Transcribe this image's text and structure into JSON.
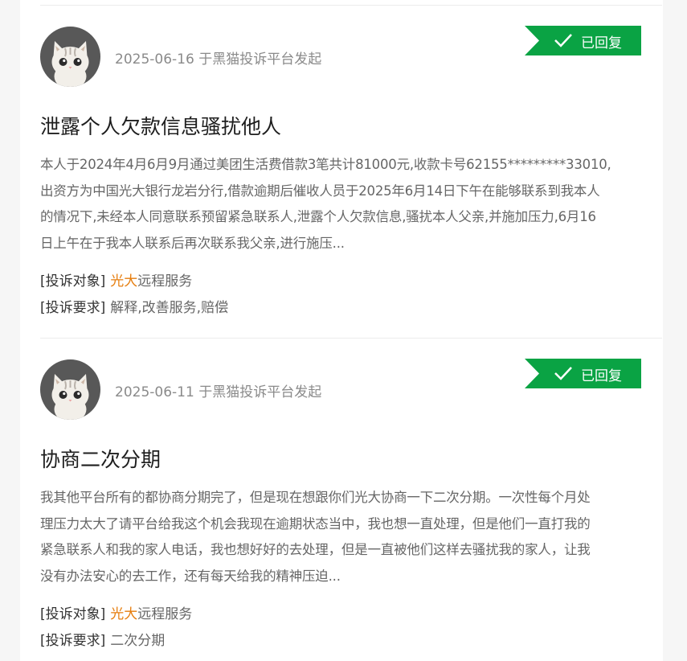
{
  "complaints": [
    {
      "date": "2025-06-16",
      "source": "于黑猫投诉平台发起",
      "status": "已回复",
      "title": "泄露个人欠款信息骚扰他人",
      "body_lines": [
        "本人于2024年4月6月9月通过美团生活费借款3笔共计81000元,收款卡号62155*********33010,",
        "出资方为中国光大银行龙岩分行,借款逾期后催收人员于2025年6月14日下午在能够联系到我本人",
        "的情况下,未经本人同意联系预留紧急联系人,泄露个人欠款信息,骚扰本人父亲,并施加压力,6月16",
        "日上午在于我本人联系后再次联系我父亲,进行施压..."
      ],
      "target_label": "[投诉对象]",
      "target_highlight": "光大",
      "target_rest": "远程服务",
      "request_label": "[投诉要求]",
      "request_value": "解释,改善服务,赔偿"
    },
    {
      "date": "2025-06-11",
      "source": "于黑猫投诉平台发起",
      "status": "已回复",
      "title": "协商二次分期",
      "body_lines": [
        "我其他平台所有的都协商分期完了，但是现在想跟你们光大协商一下二次分期。一次性每个月处",
        "理压力太大了请平台给我这个机会我现在逾期状态当中，我也想一直处理，但是他们一直打我的",
        "紧急联系人和我的家人电话，我也想好好的去处理，但是一直被他们这样去骚扰我的家人，让我",
        "没有办法安心的去工作，还有每天给我的精神压迫..."
      ],
      "target_label": "[投诉对象]",
      "target_highlight": "光大",
      "target_rest": "远程服务",
      "request_label": "[投诉要求]",
      "request_value": "二次分期"
    }
  ],
  "colors": {
    "badge_green": "#0aa344",
    "highlight_orange": "#e67e0f",
    "avatar_bg": "#585858"
  },
  "icons": {
    "avatar": "cat-avatar-icon",
    "badge_check": "checkmark-icon"
  }
}
